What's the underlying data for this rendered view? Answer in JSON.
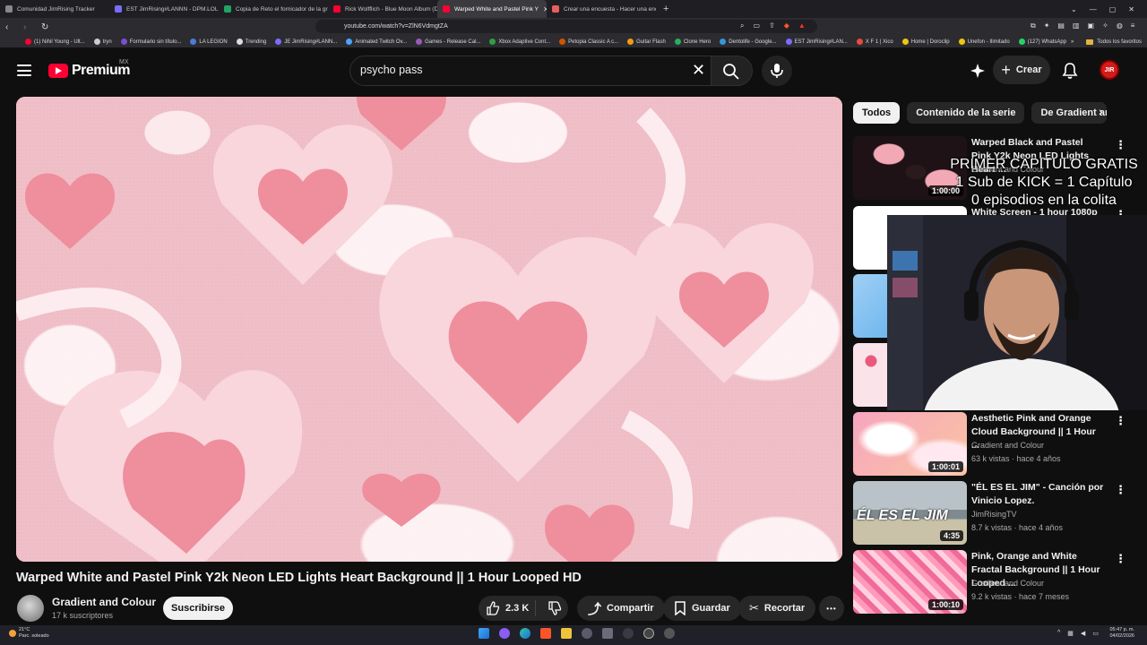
{
  "browser": {
    "tabs": [
      {
        "title": "Comunidad JimRising Tracker",
        "color": "#888888",
        "active": false
      },
      {
        "title": "EST JimRising#LANNN - DPM.LOL",
        "color": "#7b6cff",
        "active": false
      },
      {
        "title": "Copia de Reto el fornicador de la gra",
        "color": "#1fa463",
        "active": false
      },
      {
        "title": "Rick Wolfflich - Blue Moon Album (D",
        "color": "#ff0033",
        "active": false
      },
      {
        "title": "Warped White and Pastel Pink Y",
        "color": "#ff0033",
        "active": true
      },
      {
        "title": "Crear una encuesta - Hacer una encu",
        "color": "#e66060",
        "active": false
      }
    ],
    "new_tab": "+",
    "url": "youtube.com/watch?v=ZlN6VdmgtZA",
    "bookmarks": [
      {
        "label": "(1) Nihil Young - Ult...",
        "color": "#ff0033"
      },
      {
        "label": "tryn",
        "color": "#cccccc"
      },
      {
        "label": "Formulario sin título...",
        "color": "#7b4fd1"
      },
      {
        "label": "LA LEGION",
        "color": "#4c7bd9"
      },
      {
        "label": "Trending",
        "color": "#dddddd"
      },
      {
        "label": "JE JimRising#LANN...",
        "color": "#7b6cff"
      },
      {
        "label": "Animated Twitch Ov...",
        "color": "#4da3ff"
      },
      {
        "label": "Games - Release Cal...",
        "color": "#9b59b6"
      },
      {
        "label": "Xbox Adaptive Cont...",
        "color": "#2ea043"
      },
      {
        "label": "Petopia Classic A c...",
        "color": "#d35400"
      },
      {
        "label": "Guitar Flash",
        "color": "#f39c12"
      },
      {
        "label": "Clone Hero",
        "color": "#27ae60"
      },
      {
        "label": "Dentolife - Google...",
        "color": "#3498db"
      },
      {
        "label": "EST JimRising#LAN...",
        "color": "#7b6cff"
      },
      {
        "label": "X F 1 | Xico",
        "color": "#e74c3c"
      },
      {
        "label": "Home | Doroclip",
        "color": "#f1c40f"
      },
      {
        "label": "Unefon - Ilimitado",
        "color": "#f1c40f"
      },
      {
        "label": "(127) WhatsApp",
        "color": "#25d366"
      }
    ],
    "all_favorites": "Todos los favoritos"
  },
  "yt": {
    "logo_text": "Premium",
    "region": "MX",
    "search_value": "psycho pass",
    "create_label": "Crear",
    "avatar_text": "JIR",
    "video_title": "Warped White and Pastel Pink Y2k Neon LED Lights Heart Background || 1 Hour Looped HD",
    "channel_name": "Gradient and Colour",
    "subscribers": "17 k suscriptores",
    "subscribe_label": "Suscribirse",
    "likes": "2.3 K",
    "share_label": "Compartir",
    "save_label": "Guardar",
    "clip_label": "Recortar",
    "more_label": "•••",
    "chips": [
      "Todos",
      "Contenido de la serie",
      "De Gradient and"
    ],
    "recommendations": [
      {
        "title": "Warped Black and Pastel Pink Y2k Neon LED Lights Heart ...",
        "channel": "Gradient and Colour",
        "meta": "",
        "duration": "1:00:00",
        "thumb": "blackpink"
      },
      {
        "title": "White Screen - 1 hour 1080p",
        "channel": "",
        "meta": "",
        "duration": "",
        "thumb": "white"
      },
      {
        "title": "",
        "channel": "",
        "meta": "",
        "duration": "",
        "thumb": "blue"
      },
      {
        "title": "",
        "channel": "",
        "meta": "",
        "duration": "",
        "thumb": "hearts"
      },
      {
        "title": "Aesthetic Pink and Orange Cloud Background || 1 Hour ...",
        "channel": "Gradient and Colour",
        "meta": "63 k vistas · hace 4 años",
        "duration": "1:00:01",
        "thumb": "clouds"
      },
      {
        "title": "\"ÉL ES EL JIM\" - Canción por Vinicio Lopez.",
        "channel": "JimRisingTV",
        "meta": "8.7 k vistas · hace 4 años",
        "duration": "4:35",
        "thumb": "beach"
      },
      {
        "title": "Pink, Orange and White Fractal Background || 1 Hour Looped ...",
        "channel": "Gradient and Colour",
        "meta": "9.2 k vistas · hace 7 meses",
        "duration": "1:00:10",
        "thumb": "fractal"
      }
    ],
    "beach_thumb_text": "ÉL ES EL JIM"
  },
  "overlay": {
    "line1": "PRIMER CAPITULO GRATIS",
    "line2": "1 Sub de KICK = 1 Capítulo",
    "line3": "0 episodios en la colita"
  },
  "taskbar": {
    "temp": "21°C",
    "weather": "Parc. soleado",
    "time": "05:47 p. m.",
    "date": "04/02/2026"
  }
}
